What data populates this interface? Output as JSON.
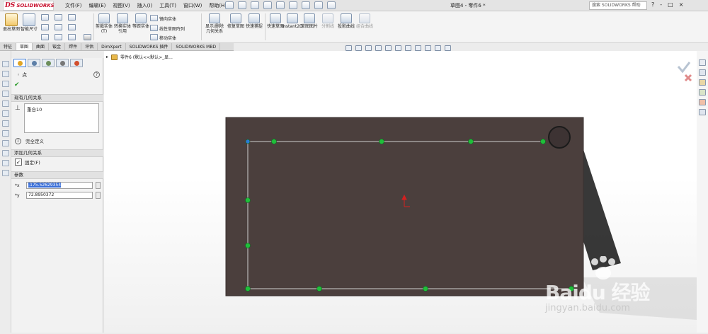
{
  "app": {
    "logo_mark": "DS",
    "logo_text": "SOLIDWORKS",
    "menus": [
      "文件(F)",
      "编辑(E)",
      "视图(V)",
      "插入(I)",
      "工具(T)",
      "窗口(W)",
      "帮助(H)"
    ],
    "document_title": "草图4 - 零件6 *",
    "search_placeholder": "搜索 SOLIDWORKS 帮助",
    "window_controls": [
      "?",
      "-",
      "□",
      "×"
    ]
  },
  "command_manager": {
    "exit_sketch": "退出草图",
    "smart_dimension": "智能尺寸",
    "trim_entities": "剪裁实体(T)",
    "convert_entities": "转换实体引用",
    "offset_entities": "等距实体",
    "mirror_entities": "镜向实体",
    "linear_pattern": "线性草图阵列",
    "move_entities": "移动实体",
    "display_relations": "显示/删除几何关系",
    "repair_sketch": "修复草图",
    "quick_snaps": "快速捕捉",
    "rapid_sketch": "快速草图",
    "instant2d": "Instant2D",
    "sketch_picture": "草图图片",
    "split_line": "分割线",
    "projected_curve": "投影曲线",
    "composite_curve": "组合曲线"
  },
  "tabs": [
    "特征",
    "草图",
    "曲面",
    "钣金",
    "焊件",
    "评估",
    "DimXpert",
    "SOLIDWORKS 插件",
    "SOLIDWORKS MBD"
  ],
  "active_tab_index": 1,
  "breadcrumb": "零件6 (默认<<默认>_显...",
  "property_manager": {
    "title": "点",
    "existing_relations_header": "现有几何关系",
    "existing_relations": [
      "重合10"
    ],
    "status_text": "完全定义",
    "add_relations_header": "添加几何关系",
    "fix_label": "固定(F)",
    "parameters_header": "参数",
    "param_x_label": "*x",
    "param_x_value": "-175.52629354",
    "param_y_label": "*y",
    "param_y_value": "72.8950372"
  },
  "watermark": {
    "brand": "Baidu 经验",
    "url": "jingyan.baidu.com"
  },
  "colors": {
    "model_face": "#4b3f3d",
    "sketch_point": "#1fbf3a",
    "sketch_line": "#d8d8d8",
    "brand_red": "#c8102e",
    "selection_blue": "#3a6fd8"
  }
}
